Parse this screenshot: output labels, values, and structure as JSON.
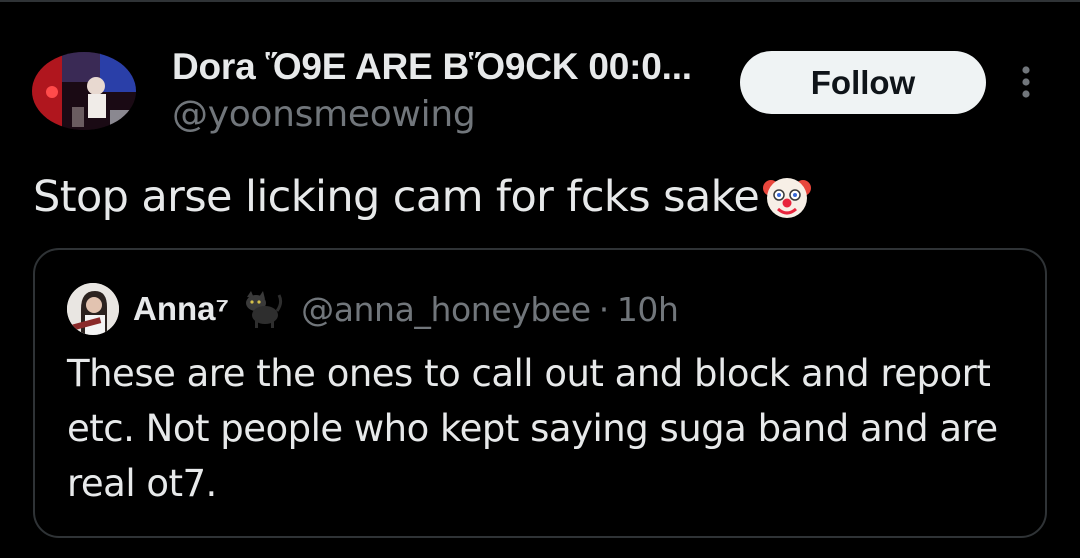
{
  "post": {
    "author": {
      "display_name": "Dora Ὅ9E ARE BὍ9CK 00:0...",
      "handle": "@yoonsmeowing"
    },
    "follow_label": "Follow",
    "text": "Stop arse licking cam for fcks sake",
    "emoji_icon": "clown-face-icon"
  },
  "quote": {
    "author": {
      "display_name": "Anna⁷",
      "handle": "@anna_honeybee",
      "separator": "·",
      "time": "10h",
      "badge_icon": "black-cat-icon"
    },
    "text": "These are the ones to call out and block and report etc. Not people who kept saying suga band and are real ot7."
  },
  "colors": {
    "background": "#000000",
    "text_primary": "#e7e9ea",
    "text_secondary": "#71767b",
    "border": "#2f3336",
    "follow_bg": "#eff3f4",
    "follow_text": "#0f1419"
  }
}
